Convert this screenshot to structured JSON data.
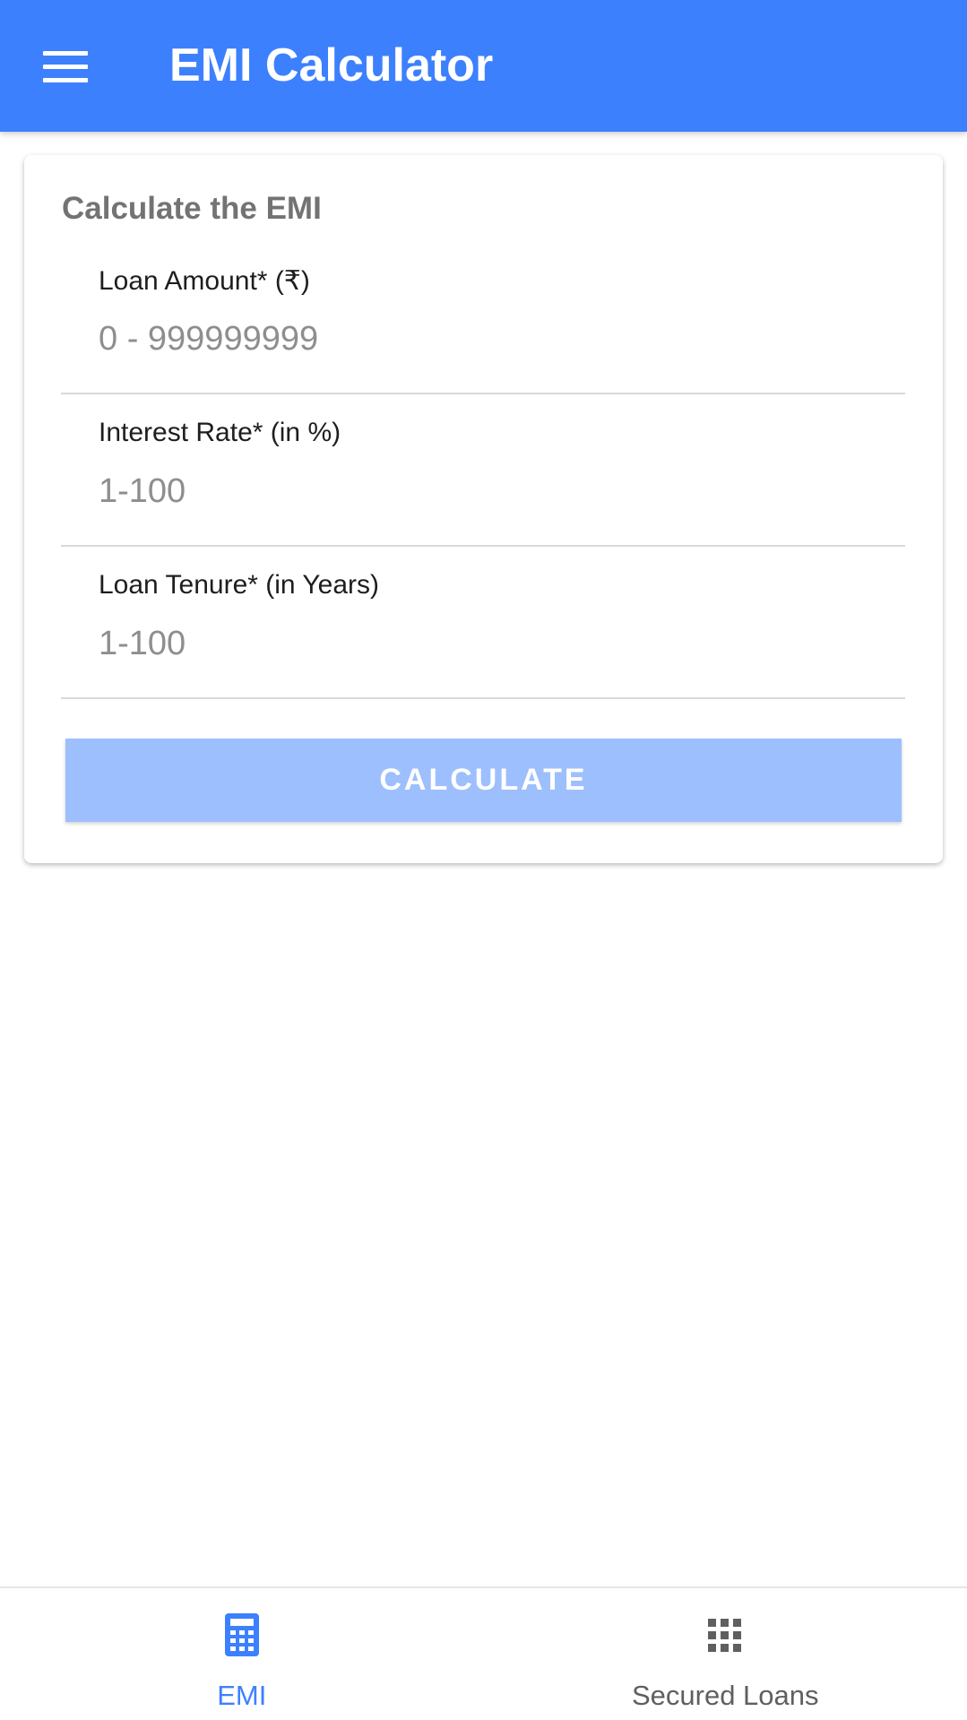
{
  "app_bar": {
    "menu_icon": "hamburger-menu-icon",
    "title": "EMI Calculator",
    "color": "#3d80fe"
  },
  "card": {
    "title": "Calculate the EMI",
    "fields": [
      {
        "label": "Loan Amount* (₹)",
        "placeholder": "0 - 999999999",
        "value": ""
      },
      {
        "label": "Interest Rate* (in %)",
        "placeholder": "1-100",
        "value": ""
      },
      {
        "label": "Loan Tenure* (in Years)",
        "placeholder": "1-100",
        "value": ""
      }
    ],
    "calculate_label": "CALCULATE",
    "calculate_color": "#9dbffd"
  },
  "bottom_nav": {
    "items": [
      {
        "label": "EMI",
        "icon": "calculator-icon",
        "active": true
      },
      {
        "label": "Secured Loans",
        "icon": "grid-apps-icon",
        "active": false
      }
    ],
    "active_color": "#3d80fe",
    "inactive_color": "#5f5f5f"
  }
}
